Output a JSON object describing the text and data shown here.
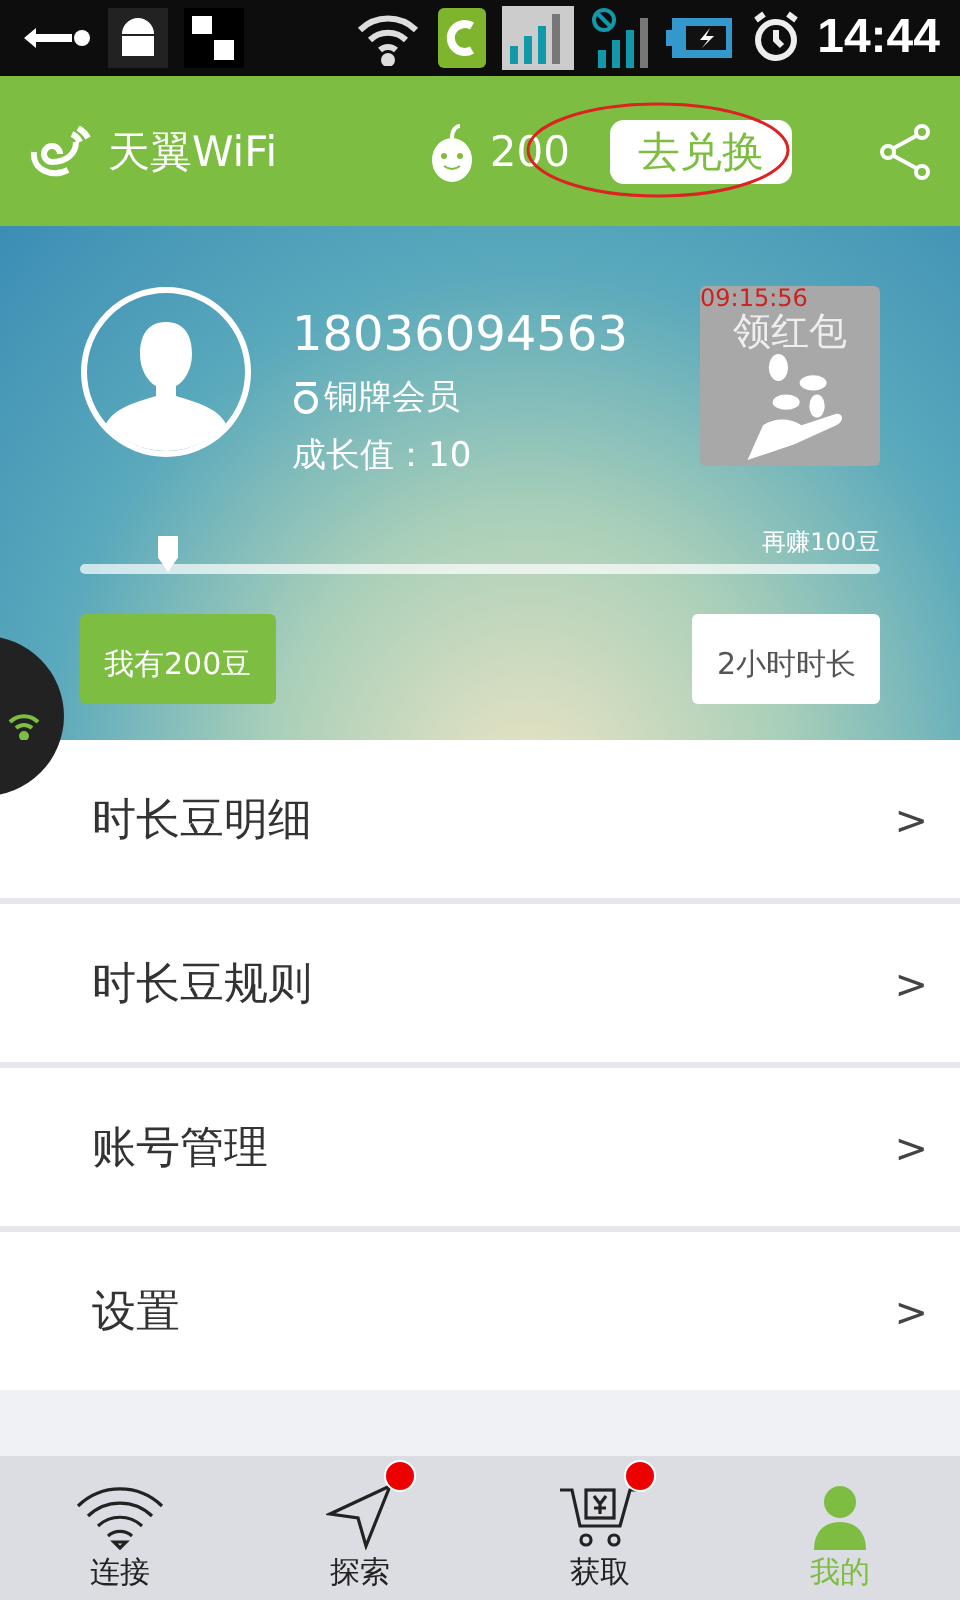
{
  "status_bar": {
    "time": "14:44"
  },
  "header": {
    "app_name": "天翼WiFi",
    "beans": "200",
    "exchange_button": "去兑换"
  },
  "profile": {
    "phone": "18036094563",
    "membership": "铜牌会员",
    "growth": "成长值：10",
    "red_packet": {
      "timer": "09:15:56",
      "label": "领红包"
    }
  },
  "progress": {
    "level": 0.11,
    "remaining": "再赚100豆",
    "current": "我有200豆",
    "target": "2小时时长"
  },
  "menu": [
    {
      "label": "时长豆明细",
      "arrow": ">"
    },
    {
      "label": "时长豆规则",
      "arrow": ">"
    },
    {
      "label": "账号管理",
      "arrow": ">"
    },
    {
      "label": "设置",
      "arrow": ">"
    }
  ],
  "tabs": [
    {
      "kind": "wifi",
      "label": "连接",
      "selected": false,
      "badge": false
    },
    {
      "kind": "explore",
      "label": "探索",
      "selected": false,
      "badge": true
    },
    {
      "kind": "cart",
      "label": "获取",
      "selected": false,
      "badge": true
    },
    {
      "kind": "user",
      "label": "我的",
      "selected": true,
      "badge": false
    }
  ]
}
